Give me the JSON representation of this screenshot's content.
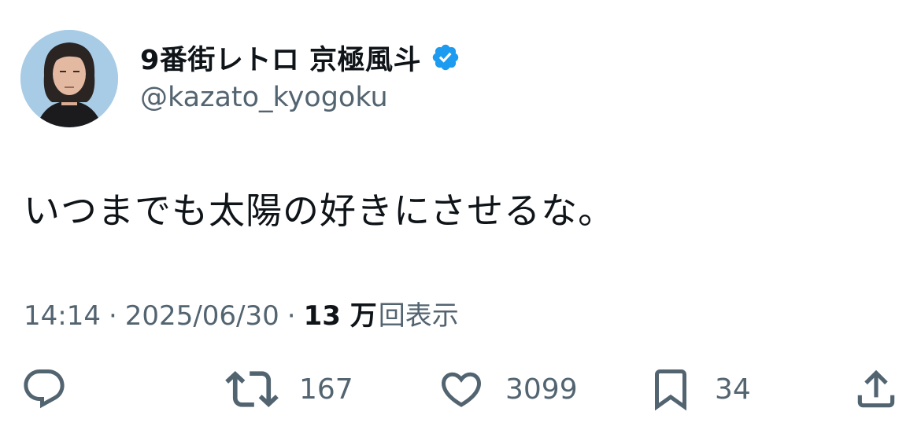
{
  "author": {
    "display_name": "9番街レトロ 京極風斗",
    "handle": "@kazato_kyogoku",
    "verified": true,
    "verified_color": "#1d9bf0"
  },
  "tweet": {
    "text": "いつまでも太陽の好きにさせるな。",
    "time": "14:14",
    "separator": "·",
    "date": "2025/06/30",
    "views_count": "13 万",
    "views_label": "回表示"
  },
  "actions": {
    "reply_icon": "reply-icon",
    "retweet_icon": "retweet-icon",
    "retweet_count": "167",
    "like_icon": "heart-icon",
    "like_count": "3099",
    "bookmark_icon": "bookmark-icon",
    "bookmark_count": "34",
    "share_icon": "share-icon",
    "icon_color": "#536471"
  }
}
